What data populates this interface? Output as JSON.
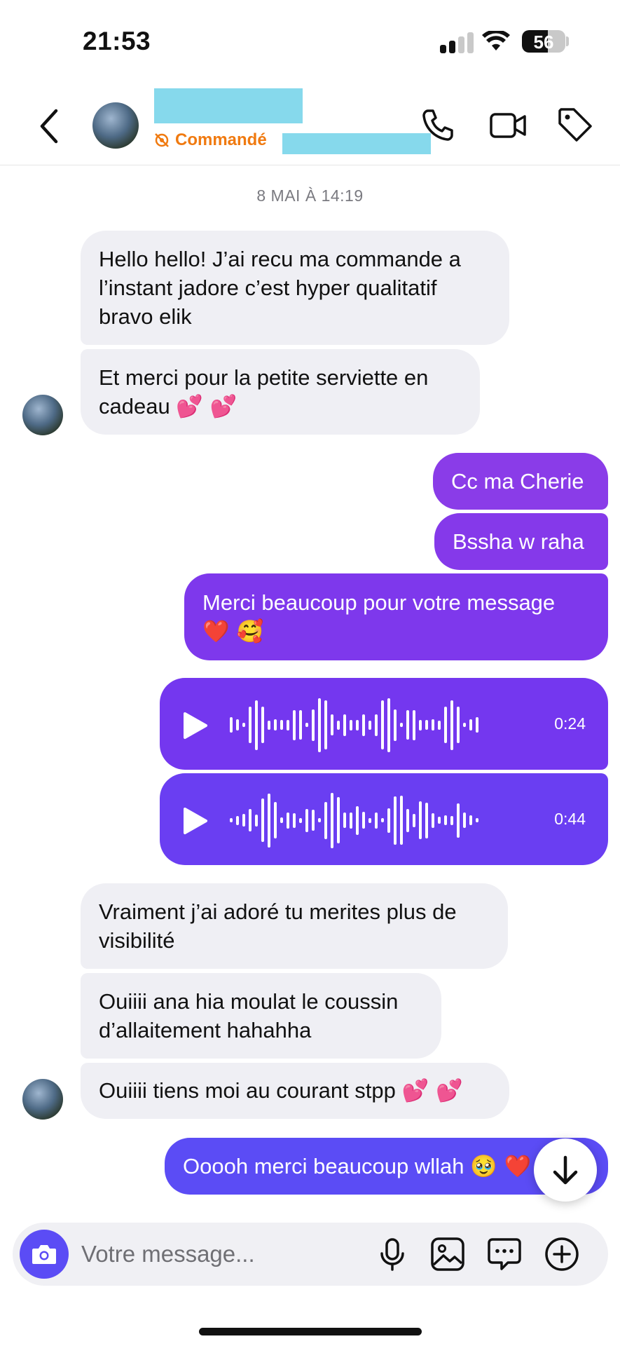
{
  "status_bar": {
    "time": "21:53",
    "battery": "56"
  },
  "header": {
    "contact_status": "Commandé",
    "back_icon": "chevron-left-icon",
    "actions": [
      "phone-icon",
      "video-camera-icon",
      "tag-icon"
    ]
  },
  "thread": {
    "date_separator": "8 MAI À 14:19",
    "incoming_1": [
      "Hello hello! J’ai recu ma commande a l’instant jadore c’est hyper qualitatif bravo elik",
      "Et merci pour la petite serviette en cadeau"
    ],
    "incoming_1_emoji": "💕 💕",
    "outgoing_1": [
      "Cc ma Cherie",
      "Bssha w raha",
      "Merci beaucoup pour votre message"
    ],
    "outgoing_1_emoji": "❤️ 🥰",
    "voice_messages": [
      {
        "duration": "0:24",
        "progress": 0
      },
      {
        "duration": "0:44",
        "progress": 0
      }
    ],
    "incoming_2": [
      "Vraiment j’ai adoré tu merites plus de visibilité",
      "Ouiiii ana hia moulat le coussin d’allaitement hahahha",
      "Ouiiii tiens moi au courant stpp"
    ],
    "incoming_2_emoji": "💕 💕",
    "outgoing_2": "Ooooh merci beaucoup wllah",
    "outgoing_2_emoji": "🥹 ❤️"
  },
  "composer": {
    "placeholder": "Votre message...",
    "icons": [
      "camera-icon",
      "microphone-icon",
      "image-icon",
      "quick-reply-icon",
      "plus-circle-icon"
    ]
  },
  "colors": {
    "incoming_bubble": "#efeff4",
    "outgoing_gradient_top": "#8a3ce8",
    "outgoing_gradient_bottom": "#5b4cf5",
    "accent": "#5b4cf5",
    "status_orange": "#f07a10",
    "redaction": "#86d9ec"
  }
}
